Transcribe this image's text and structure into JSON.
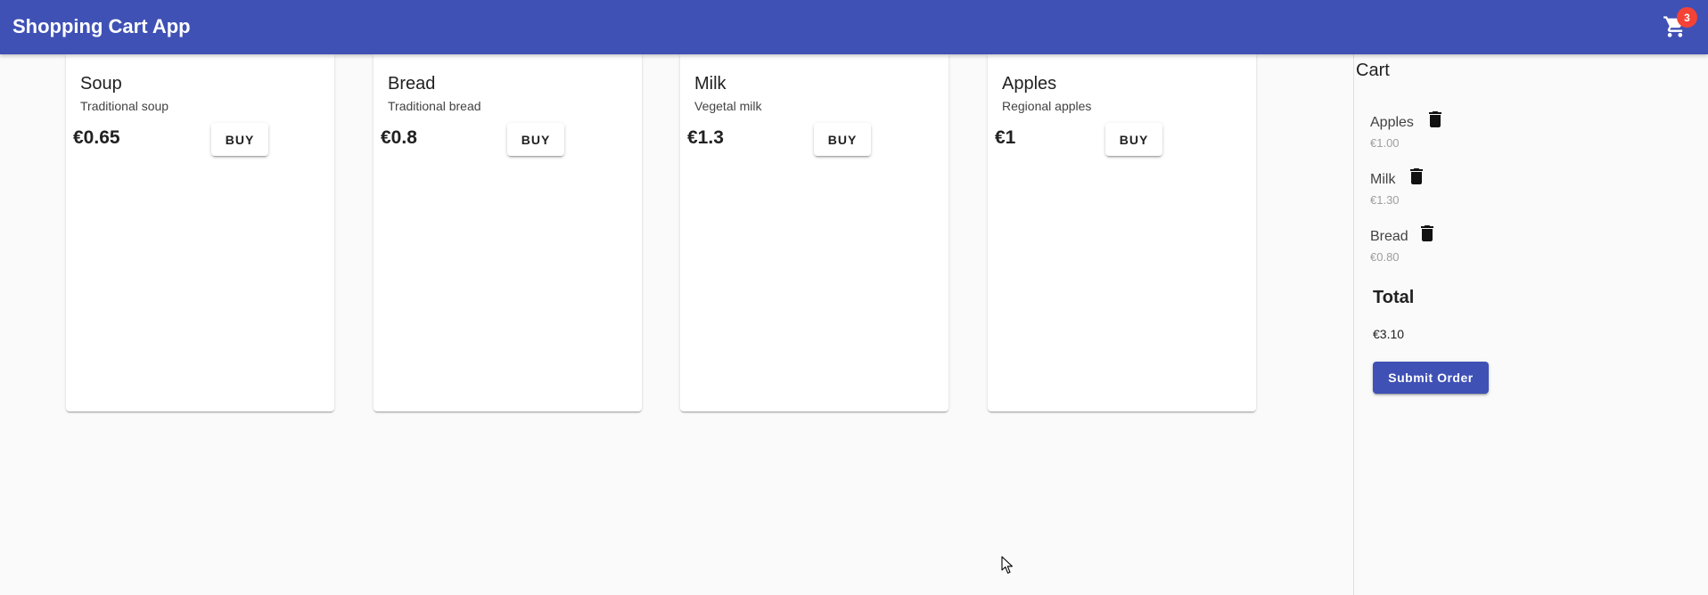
{
  "app": {
    "title": "Shopping Cart App",
    "cart_icon": "shopping-cart-icon",
    "cart_count": "3",
    "colors": {
      "primary": "#3f51b5",
      "badge": "#f44336",
      "background": "#fafafa"
    }
  },
  "products": [
    {
      "name": "Soup",
      "description": "Traditional soup",
      "price": "€0.65",
      "buy_label": "BUY"
    },
    {
      "name": "Bread",
      "description": "Traditional bread",
      "price": "€0.8",
      "buy_label": "BUY"
    },
    {
      "name": "Milk",
      "description": "Vegetal milk",
      "price": "€1.3",
      "buy_label": "BUY"
    },
    {
      "name": "Apples",
      "description": "Regional apples",
      "price": "€1",
      "buy_label": "BUY"
    }
  ],
  "cart": {
    "title": "Cart",
    "items": [
      {
        "name": "Apples",
        "price": "€1.00",
        "delete_icon": "trash-icon"
      },
      {
        "name": "Milk",
        "price": "€1.30",
        "delete_icon": "trash-icon"
      },
      {
        "name": "Bread",
        "price": "€0.80",
        "delete_icon": "trash-icon"
      }
    ],
    "total_label": "Total",
    "total_value": "€3.10",
    "submit_label": "Submit Order"
  }
}
